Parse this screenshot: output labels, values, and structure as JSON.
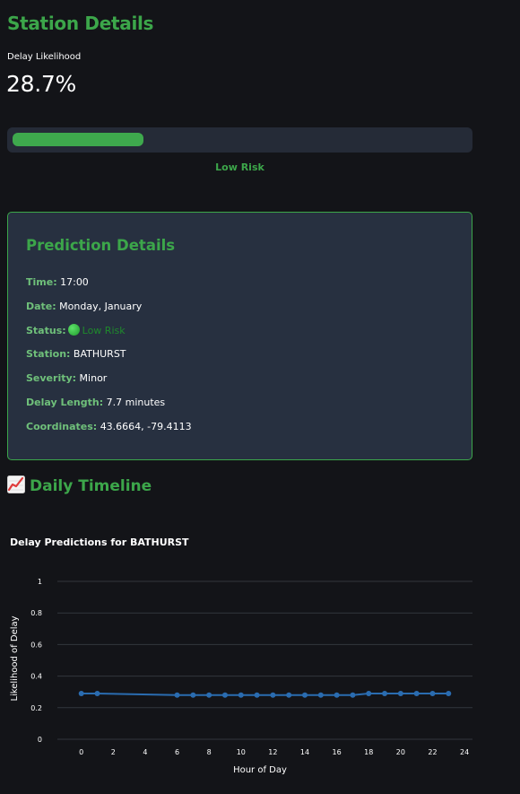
{
  "station_section": {
    "title": "Station Details",
    "metric_label": "Delay Likelihood",
    "metric_value": "28.7%",
    "likelihood": 0.287,
    "risk_label": "Low Risk",
    "risk_color": "#3ca64a"
  },
  "prediction_details": {
    "title": "Prediction Details",
    "rows": [
      {
        "key": "Time:",
        "value": "17:00"
      },
      {
        "key": "Date:",
        "value": "Monday, January"
      },
      {
        "key": "Status:",
        "value": "Low Risk",
        "icon": "green-circle-icon"
      },
      {
        "key": "Station:",
        "value": "BATHURST"
      },
      {
        "key": "Severity:",
        "value": "Minor"
      },
      {
        "key": "Delay Length:",
        "value": "7.7 minutes"
      },
      {
        "key": "Coordinates:",
        "value": "43.6664, -79.4113"
      }
    ]
  },
  "timeline": {
    "title": "Daily Timeline",
    "icon": "chart-increasing-icon"
  },
  "chart_data": {
    "type": "line",
    "title": "Delay Predictions for BATHURST",
    "xlabel": "Hour of Day",
    "ylabel": "Likelihood of Delay",
    "xlim": [
      -1.5,
      24.5
    ],
    "ylim": [
      0,
      1
    ],
    "x_ticks": [
      0,
      2,
      4,
      6,
      8,
      10,
      12,
      14,
      16,
      18,
      20,
      22,
      24
    ],
    "y_ticks": [
      0,
      0.2,
      0.4,
      0.6,
      0.8,
      1
    ],
    "y_tick_labels": [
      "0",
      "0.2",
      "0.4",
      "0.6",
      "0.8",
      "1"
    ],
    "grid": true,
    "series": [
      {
        "color": "#2a6cb0",
        "x": [
          0,
          1,
          6,
          7,
          8,
          9,
          10,
          11,
          12,
          13,
          14,
          15,
          16,
          17,
          18,
          19,
          20,
          21,
          22,
          23
        ],
        "values": [
          0.29,
          0.29,
          0.28,
          0.28,
          0.28,
          0.28,
          0.28,
          0.28,
          0.28,
          0.28,
          0.28,
          0.28,
          0.28,
          0.28,
          0.29,
          0.29,
          0.29,
          0.29,
          0.29,
          0.29
        ]
      }
    ]
  }
}
